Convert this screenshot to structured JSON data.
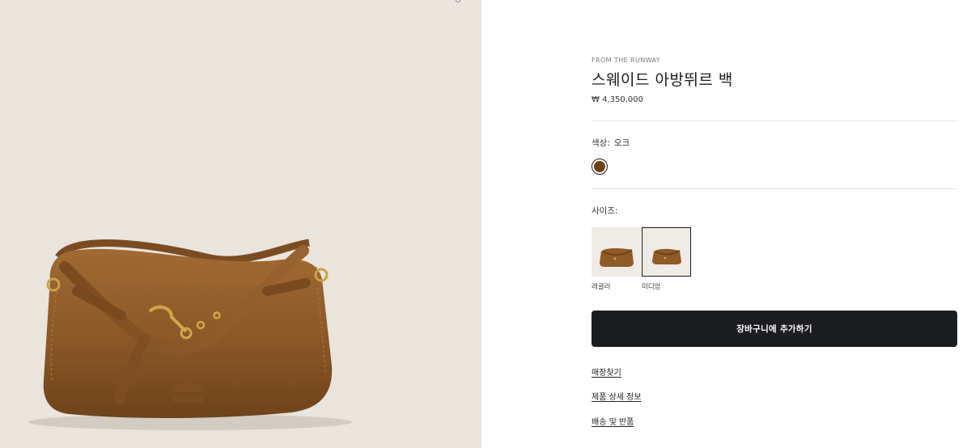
{
  "product": {
    "eyebrow": "FROM THE RUNWAY",
    "title": "스웨이드 아방뛰르 백",
    "price": "₩ 4,350,000",
    "image_icon": "suede-shoulder-bag-photo",
    "image_color": "#8a5a2a"
  },
  "color_selector": {
    "label": "색상:",
    "value": "오크",
    "swatch_color": "#6b4218"
  },
  "size_selector": {
    "label": "사이즈:",
    "options": [
      {
        "name": "레귤러",
        "selected": false
      },
      {
        "name": "미디엄",
        "selected": true
      }
    ]
  },
  "actions": {
    "add_to_cart": "장바구니에 추가하기"
  },
  "links": {
    "find_store": "매장찾기",
    "product_details": "제품 상세 정보",
    "shipping_returns": "배송 및 반품"
  }
}
